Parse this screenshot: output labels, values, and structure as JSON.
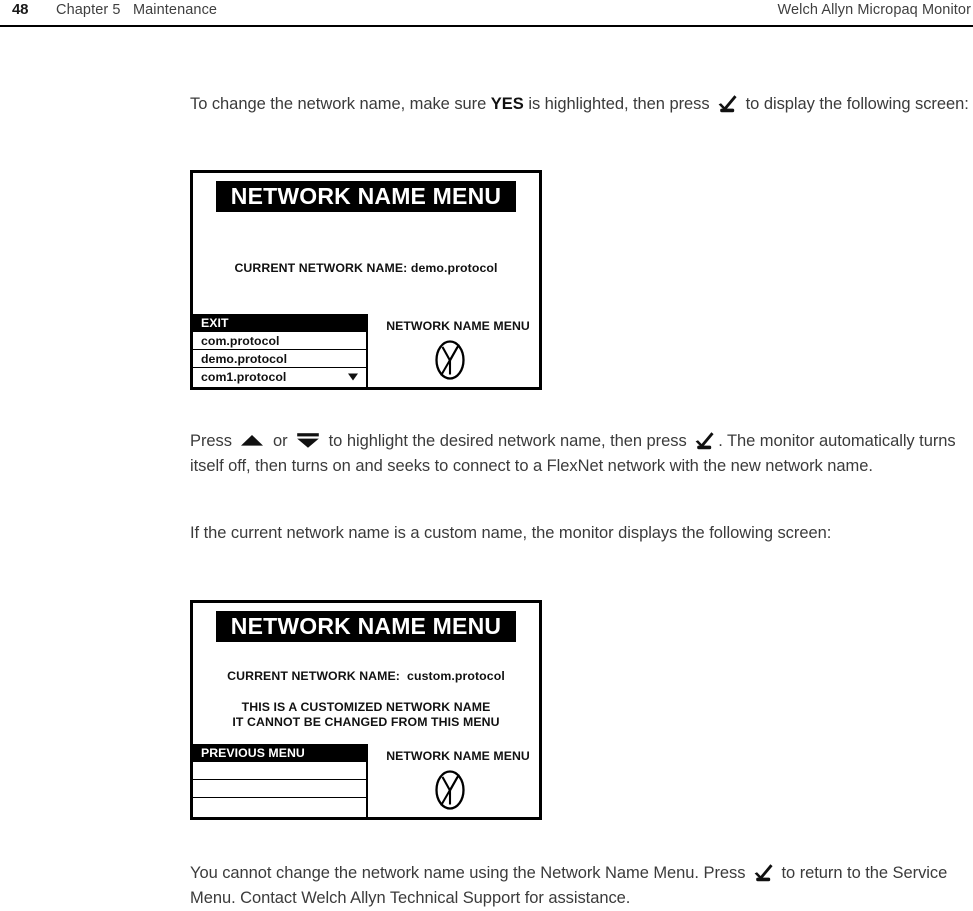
{
  "header": {
    "page_number": "48",
    "chapter": "Chapter 5   Maintenance",
    "product": "Welch Allyn Micropaq Monitor"
  },
  "paragraphs": {
    "p1_a": "To change the network name, make sure ",
    "p1_yes": "YES",
    "p1_b": " is highlighted, then press ",
    "p1_c": " to display the following screen:",
    "p2_a": "Press ",
    "p2_b": " or ",
    "p2_c": " to highlight the desired network name, then press ",
    "p2_d": ". The monitor automatically turns itself off, then turns on and seeks to connect to a FlexNet network with the new network name.",
    "p3": "If the current network name is a custom name, the monitor displays the following screen:",
    "p4_a": "You cannot change the network name using the Network Name Menu. Press ",
    "p4_b": " to return to the Service Menu. Contact Welch Allyn Technical Support for assistance."
  },
  "icons": {
    "check": "check-key-icon",
    "up": "up-arrow-key-icon",
    "down": "down-arrow-key-icon",
    "network": "no-network-antenna-icon",
    "caret": "scroll-down-caret-icon"
  },
  "screen_1": {
    "title": "NETWORK NAME MENU",
    "current_network": "CURRENT NETWORK NAME: demo.protocol",
    "right_label": "NETWORK NAME MENU",
    "list": [
      {
        "label": "EXIT",
        "selected": true,
        "caret": false
      },
      {
        "label": "com.protocol",
        "selected": false,
        "caret": false
      },
      {
        "label": "demo.protocol",
        "selected": false,
        "caret": false
      },
      {
        "label": "com1.protocol",
        "selected": false,
        "caret": true
      }
    ]
  },
  "screen_2": {
    "title": "NETWORK NAME MENU",
    "current_network": "CURRENT NETWORK NAME:  custom.protocol",
    "note_line_1": "THIS IS A CUSTOMIZED NETWORK NAME",
    "note_line_2": "IT CANNOT BE CHANGED FROM THIS MENU",
    "right_label": "NETWORK NAME MENU",
    "list": [
      {
        "label": "PREVIOUS MENU",
        "selected": true,
        "caret": false
      },
      {
        "label": "",
        "selected": false,
        "caret": false
      },
      {
        "label": "",
        "selected": false,
        "caret": false
      },
      {
        "label": "",
        "selected": false,
        "caret": false
      }
    ]
  },
  "colors": {
    "ink": "#3b3b3b",
    "screen_bg": "#ffffff",
    "screen_fg": "#000000",
    "selected_bg": "#000000",
    "selected_fg": "#ffffff"
  }
}
